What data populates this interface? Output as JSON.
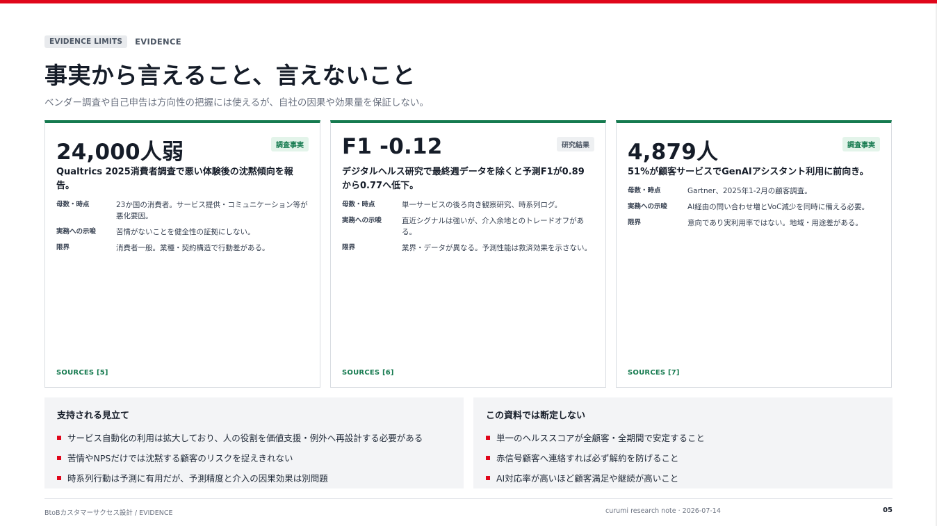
{
  "header": {
    "eyebrow_badge": "EVIDENCE LIMITS",
    "eyebrow_text": "EVIDENCE",
    "title": "事実から言えること、言えないこと",
    "subtitle": "ベンダー調査や自己申告は方向性の把握には使えるが、自社の因果や効果量を保証しない。"
  },
  "colors": {
    "accent_red": "#e0061b",
    "accent_green": "#157a4f"
  },
  "cards": [
    {
      "value": "24,000人弱",
      "tag": "調査事実",
      "headline": "Qualtrics 2025消費者調査で悪い体験後の沈黙傾向を報告。",
      "details": [
        {
          "label": "母数・時点",
          "text": "23か国の消費者。サービス提供・コミュニケーション等が悪化要因。"
        },
        {
          "label": "実務への示唆",
          "text": "苦情がないことを健全性の証拠にしない。"
        },
        {
          "label": "限界",
          "text": "消費者一般。業種・契約構造で行動差がある。"
        }
      ],
      "sources": "SOURCES [5]"
    },
    {
      "value": "F1 -0.12",
      "tag": "研究結果",
      "headline": "デジタルヘルス研究で最終週データを除くと予測F1が0.89から0.77へ低下。",
      "details": [
        {
          "label": "母数・時点",
          "text": "単一サービスの後ろ向き観察研究、時系列ログ。"
        },
        {
          "label": "実務への示唆",
          "text": "直近シグナルは強いが、介入余地とのトレードオフがある。"
        },
        {
          "label": "限界",
          "text": "業界・データが異なる。予測性能は救済効果を示さない。"
        }
      ],
      "sources": "SOURCES [6]"
    },
    {
      "value": "4,879人",
      "tag": "調査事実",
      "headline": "51%が顧客サービスでGenAIアシスタント利用に前向き。",
      "details": [
        {
          "label": "母数・時点",
          "text": "Gartner、2025年1-2月の顧客調査。"
        },
        {
          "label": "実務への示唆",
          "text": "AI経由の問い合わせ増とVoC減少を同時に備える必要。"
        },
        {
          "label": "限界",
          "text": "意向であり実利用率ではない。地域・用途差がある。"
        }
      ],
      "sources": "SOURCES [7]"
    }
  ],
  "supported": {
    "title": "支持される見立て",
    "items": [
      "サービス自動化の利用は拡大しており、人の役割を価値支援・例外へ再設計する必要がある",
      "苦情やNPSだけでは沈黙する顧客のリスクを捉えきれない",
      "時系列行動は予測に有用だが、予測精度と介入の因果効果は別問題"
    ]
  },
  "not_asserted": {
    "title": "この資料では断定しない",
    "items": [
      "単一のヘルススコアが全顧客・全期間で安定すること",
      "赤信号顧客へ連絡すれば必ず解約を防げること",
      "AI対応率が高いほど顧客満足や継続が高いこと"
    ]
  },
  "footer": {
    "left": "BtoBカスタマーサクセス設計 / EVIDENCE",
    "center": "curumi research note · 2026-07-14",
    "page": "05"
  }
}
